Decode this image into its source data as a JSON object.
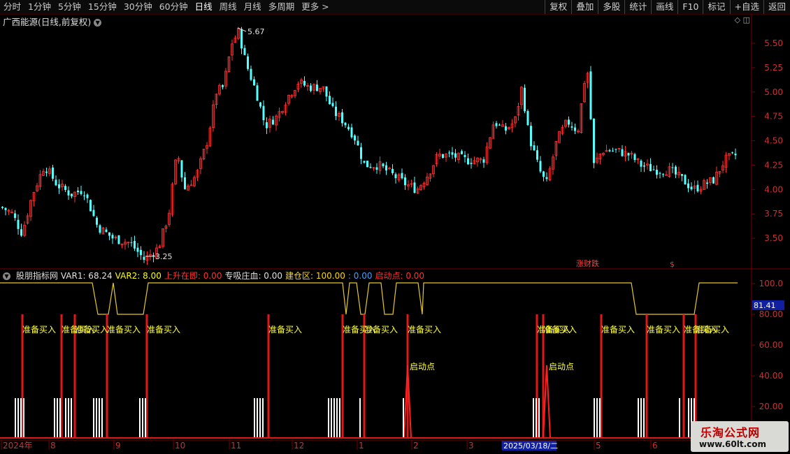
{
  "toolbar": {
    "periods": [
      "分时",
      "1分钟",
      "5分钟",
      "15分钟",
      "30分钟",
      "60分钟",
      "日线",
      "周线",
      "月线",
      "多周期",
      "更多 >"
    ],
    "active_period": "日线",
    "right_buttons": [
      "复权",
      "叠加",
      "多股",
      "统计",
      "画线",
      "F10",
      "标记",
      "+自选",
      "返回"
    ]
  },
  "stock": {
    "title": "广西能源(日线,前复权)",
    "high_label": "5.67",
    "low_label": "3.25",
    "event_labels": [
      "涨财跌",
      "$"
    ]
  },
  "price_axis": [
    "5.50",
    "5.25",
    "5.00",
    "4.75",
    "4.50",
    "4.25",
    "4.00",
    "3.75",
    "3.50"
  ],
  "indicator": {
    "name": "股朋指标网",
    "values": [
      {
        "label": "VAR1: 68.24",
        "color": "#e0e0e0"
      },
      {
        "label": "VAR2: 8.00",
        "color": "#ffff00"
      },
      {
        "label": "上升在即: 0.00",
        "color": "#ff3030"
      },
      {
        "label": "专吸庄血: 0.00",
        "color": "#e0e0e0"
      },
      {
        "label": "建仓区: 100.00",
        "color": "#ffd700"
      },
      {
        "label": ": 0.00",
        "color": "#40a0ff"
      },
      {
        "label": "启动点: 0.00",
        "color": "#ff3030"
      }
    ],
    "axis": [
      "100.0",
      "80.00",
      "60.00",
      "40.00",
      "20.00"
    ],
    "current_value": "81.41",
    "prepare_label": "准备买入",
    "launch_label": "启动点"
  },
  "date_axis": [
    "2024年",
    "8",
    "9",
    "10",
    "11",
    "12",
    "1",
    "2",
    "3",
    "2025/03/18/二",
    "5",
    "6"
  ],
  "watermark": {
    "line1": "乐淘公式网",
    "line2": "www.60lt.com"
  },
  "colors": {
    "up": "#ff3232",
    "down": "#54ffff",
    "background": "#000000",
    "grid": "#7a0000"
  }
}
